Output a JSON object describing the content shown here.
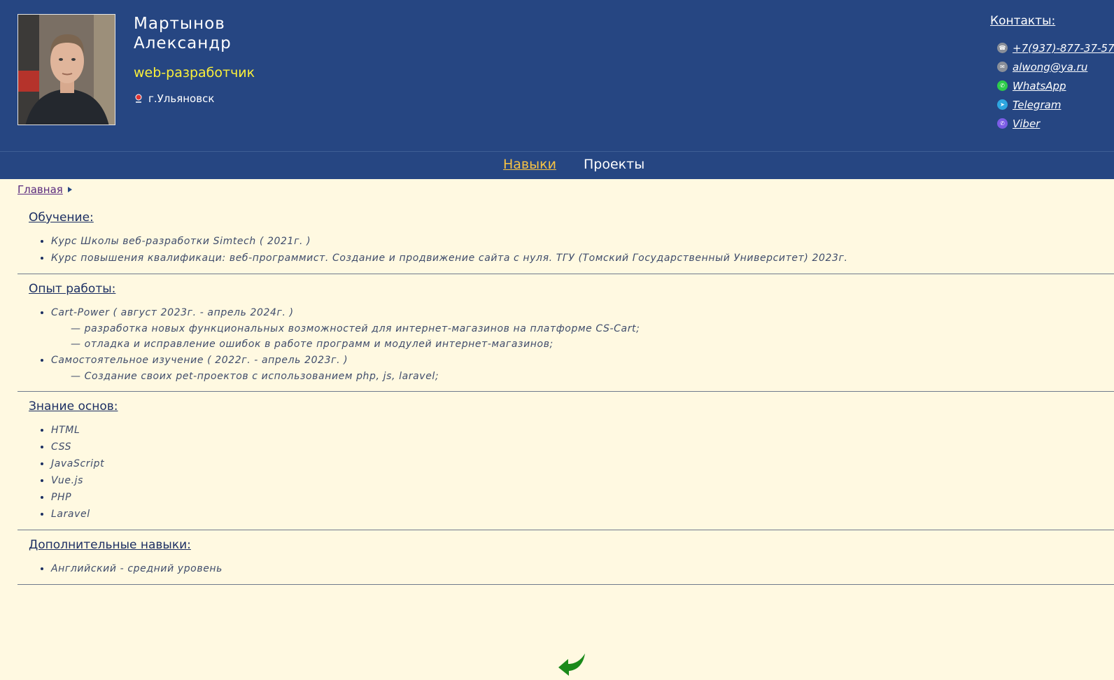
{
  "header": {
    "name_last": "Мартынов",
    "name_first": "Александр",
    "role": "web-разработчик",
    "city": "г.Ульяновск",
    "contacts_title": "Контакты:",
    "contacts": [
      {
        "icon": "phone-icon",
        "label": "+7(937)-877-37-57",
        "color": "#8a8f99"
      },
      {
        "icon": "mail-icon",
        "label": "alwong@ya.ru",
        "color": "#8a8f99"
      },
      {
        "icon": "whatsapp-icon",
        "label": "WhatsApp",
        "color": "#2ecc4a"
      },
      {
        "icon": "telegram-icon",
        "label": "Telegram",
        "color": "#2ea6e0"
      },
      {
        "icon": "viber-icon",
        "label": "Viber",
        "color": "#7b5ce6"
      }
    ]
  },
  "nav": {
    "skills": "Навыки",
    "projects": "Проекты"
  },
  "breadcrumb": {
    "home": "Главная"
  },
  "sections": {
    "education": {
      "title": "Обучение:",
      "items": [
        "Курс Школы веб-разработки Simtech ( 2021г. )",
        "Курс повышения квалификаци: веб-программист. Создание и продвижение сайта с нуля. ТГУ (Томский Государственный Университет) 2023г."
      ]
    },
    "experience": {
      "title": "Опыт работы:",
      "job1": "Cart-Power ( август 2023г. - апрель 2024г. )",
      "job1_sub": [
        "— разработка новых функциональных возможностей для интернет-магазинов на платформе CS-Cart;",
        "— отладка и исправление ошибок в работе программ и модулей интернет-магазинов;"
      ],
      "job2": "Самостоятельное изучение ( 2022г. - апрель 2023г. )",
      "job2_sub": [
        "— Создание своих pet-проектов с использованием php, js, laravel;"
      ]
    },
    "basics": {
      "title": "Знание основ:",
      "items": [
        "HTML",
        "CSS",
        "JavaScript",
        "Vue.js",
        "PHP",
        "Laravel"
      ]
    },
    "extra": {
      "title": "Дополнительные навыки:",
      "items": [
        "Английский - средний уровень"
      ]
    }
  },
  "colors": {
    "header_bg": "#264682",
    "page_bg": "#fff9e1",
    "role": "#fbf03a",
    "nav_active": "#f6c244",
    "back_arrow": "#1a8a1a"
  }
}
